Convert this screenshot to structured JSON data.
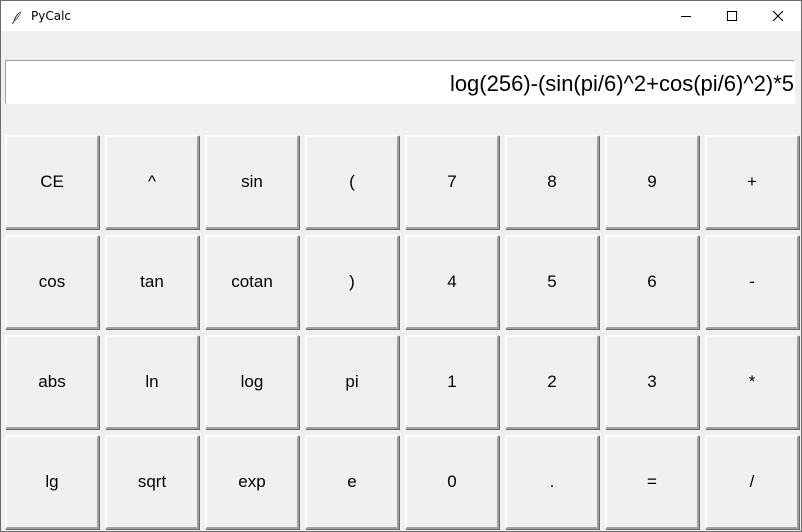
{
  "window": {
    "title": "PyCalc"
  },
  "display": {
    "expression": "log(256)-(sin(pi/6)^2+cos(pi/6)^2)*5"
  },
  "keypad": {
    "rows": [
      [
        "CE",
        "^",
        "sin",
        "(",
        "7",
        "8",
        "9",
        "+"
      ],
      [
        "cos",
        "tan",
        "cotan",
        ")",
        "4",
        "5",
        "6",
        "-"
      ],
      [
        "abs",
        "ln",
        "log",
        "pi",
        "1",
        "2",
        "3",
        "*"
      ],
      [
        "lg",
        "sqrt",
        "exp",
        "e",
        "0",
        ".",
        "=",
        "/"
      ]
    ]
  },
  "icons": {
    "app": "feather-icon",
    "minimize": "minimize-icon",
    "maximize": "maximize-icon",
    "close": "close-icon"
  }
}
